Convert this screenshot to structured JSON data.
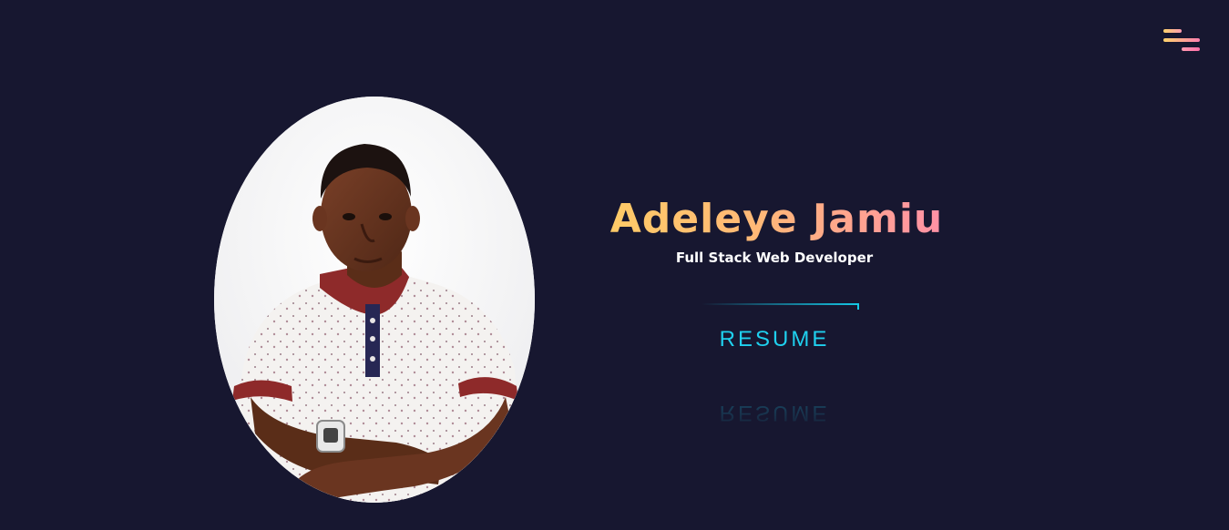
{
  "header": {
    "menu_icon": "hamburger-menu-icon",
    "accent_colors": [
      "#ffd36b",
      "#ff7fb0"
    ]
  },
  "hero": {
    "name": "Adeleye Jamiu",
    "role": "Full Stack Web Developer",
    "resume_label": "RESUME",
    "portrait_icon": "profile-photo"
  },
  "colors": {
    "background": "#171730",
    "accent_cyan": "#1fd0ee",
    "name_gradient_start": "#ffcc66",
    "name_gradient_end": "#ff8fa8"
  }
}
